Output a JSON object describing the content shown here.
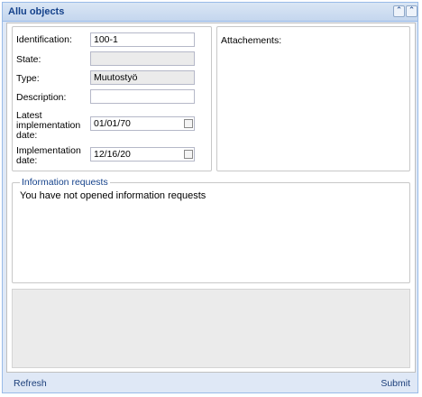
{
  "window": {
    "title": "Allu objects"
  },
  "form": {
    "identification_label": "Identification:",
    "identification_value": "100-1",
    "state_label": "State:",
    "state_value": "",
    "type_label": "Type:",
    "type_value": "Muutostyö",
    "description_label": "Description:",
    "description_value": "",
    "latest_label_1": "Latest",
    "latest_label_2": "implementation",
    "latest_label_3": "date:",
    "latest_value": "01/01/70",
    "impl_label_1": "Implementation",
    "impl_label_2": "date:",
    "impl_value": "12/16/20"
  },
  "attachments": {
    "label": "Attachements:"
  },
  "info_requests": {
    "legend": "Information requests",
    "empty_text": "You have not opened information requests"
  },
  "footer": {
    "refresh_label": "Refresh",
    "submit_label": "Submit"
  },
  "icons": {
    "collapse": "collapse-up-icon",
    "close": "close-icon",
    "calendar": "calendar-icon"
  },
  "colors": {
    "title_text": "#15428b",
    "border": "#99bbe8",
    "frame_bg": "#dfe8f6"
  }
}
